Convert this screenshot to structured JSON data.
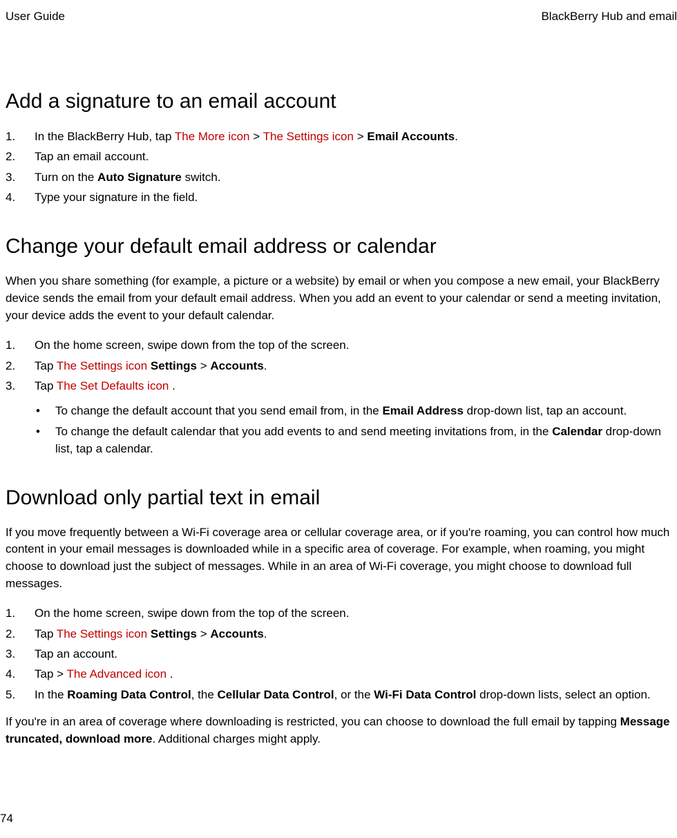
{
  "header": {
    "left": "User Guide",
    "right": "BlackBerry Hub and email"
  },
  "icons": {
    "more": "The More icon",
    "settings": "The Settings icon",
    "setDefaults": "The Set Defaults icon",
    "advanced": "The Advanced icon"
  },
  "section1": {
    "heading": "Add a signature to an email account",
    "step1_a": "In the BlackBerry Hub, tap ",
    "step1_b": " > ",
    "step1_c": " > ",
    "step1_bold": "Email Accounts",
    "step1_end": ".",
    "step2": "Tap an email account.",
    "step3_a": "Turn on the ",
    "step3_bold": "Auto Signature",
    "step3_b": " switch.",
    "step4": "Type your signature in the field."
  },
  "section2": {
    "heading": "Change your default email address or calendar",
    "intro": "When you share something (for example, a picture or a website) by email or when you compose a new email, your BlackBerry device sends the email from your default email address. When you add an event to your calendar or send a meeting invitation, your device adds the event to your default calendar.",
    "step1": "On the home screen, swipe down from the top of the screen.",
    "step2_a": "Tap ",
    "step2_b": " ",
    "step2_bold1": "Settings",
    "step2_c": " > ",
    "step2_bold2": "Accounts",
    "step2_d": ".",
    "step3_a": "Tap ",
    "step3_b": " .",
    "bullet1_a": "To change the default account that you send email from, in the ",
    "bullet1_bold": "Email Address",
    "bullet1_b": " drop-down list, tap an account.",
    "bullet2_a": "To change the default calendar that you add events to and send meeting invitations from, in the ",
    "bullet2_bold": "Calendar",
    "bullet2_b": " drop-down list, tap a calendar."
  },
  "section3": {
    "heading": "Download only partial text in email",
    "intro": "If you move frequently between a Wi-Fi coverage area or cellular coverage area, or if you're roaming, you can control how much content in your email messages is downloaded while in a specific area of coverage. For example, when roaming, you might choose to download just the subject of messages. While in an area of Wi-Fi coverage, you might choose to download full messages.",
    "step1": "On the home screen, swipe down from the top of the screen.",
    "step2_a": "Tap ",
    "step2_b": " ",
    "step2_bold1": "Settings",
    "step2_c": " > ",
    "step2_bold2": "Accounts",
    "step2_d": ".",
    "step3": "Tap an account.",
    "step4_a": "Tap > ",
    "step4_b": " .",
    "step5_a": "In the ",
    "step5_bold1": "Roaming Data Control",
    "step5_b": ", the ",
    "step5_bold2": "Cellular Data Control",
    "step5_c": ", or the ",
    "step5_bold3": "Wi-Fi Data Control",
    "step5_d": " drop-down lists, select an option.",
    "post_a": "If you're in an area of coverage where downloading is restricted, you can choose to download the full email by tapping ",
    "post_bold": "Message truncated, download more",
    "post_b": ". Additional charges might apply."
  },
  "pageNumber": "74"
}
